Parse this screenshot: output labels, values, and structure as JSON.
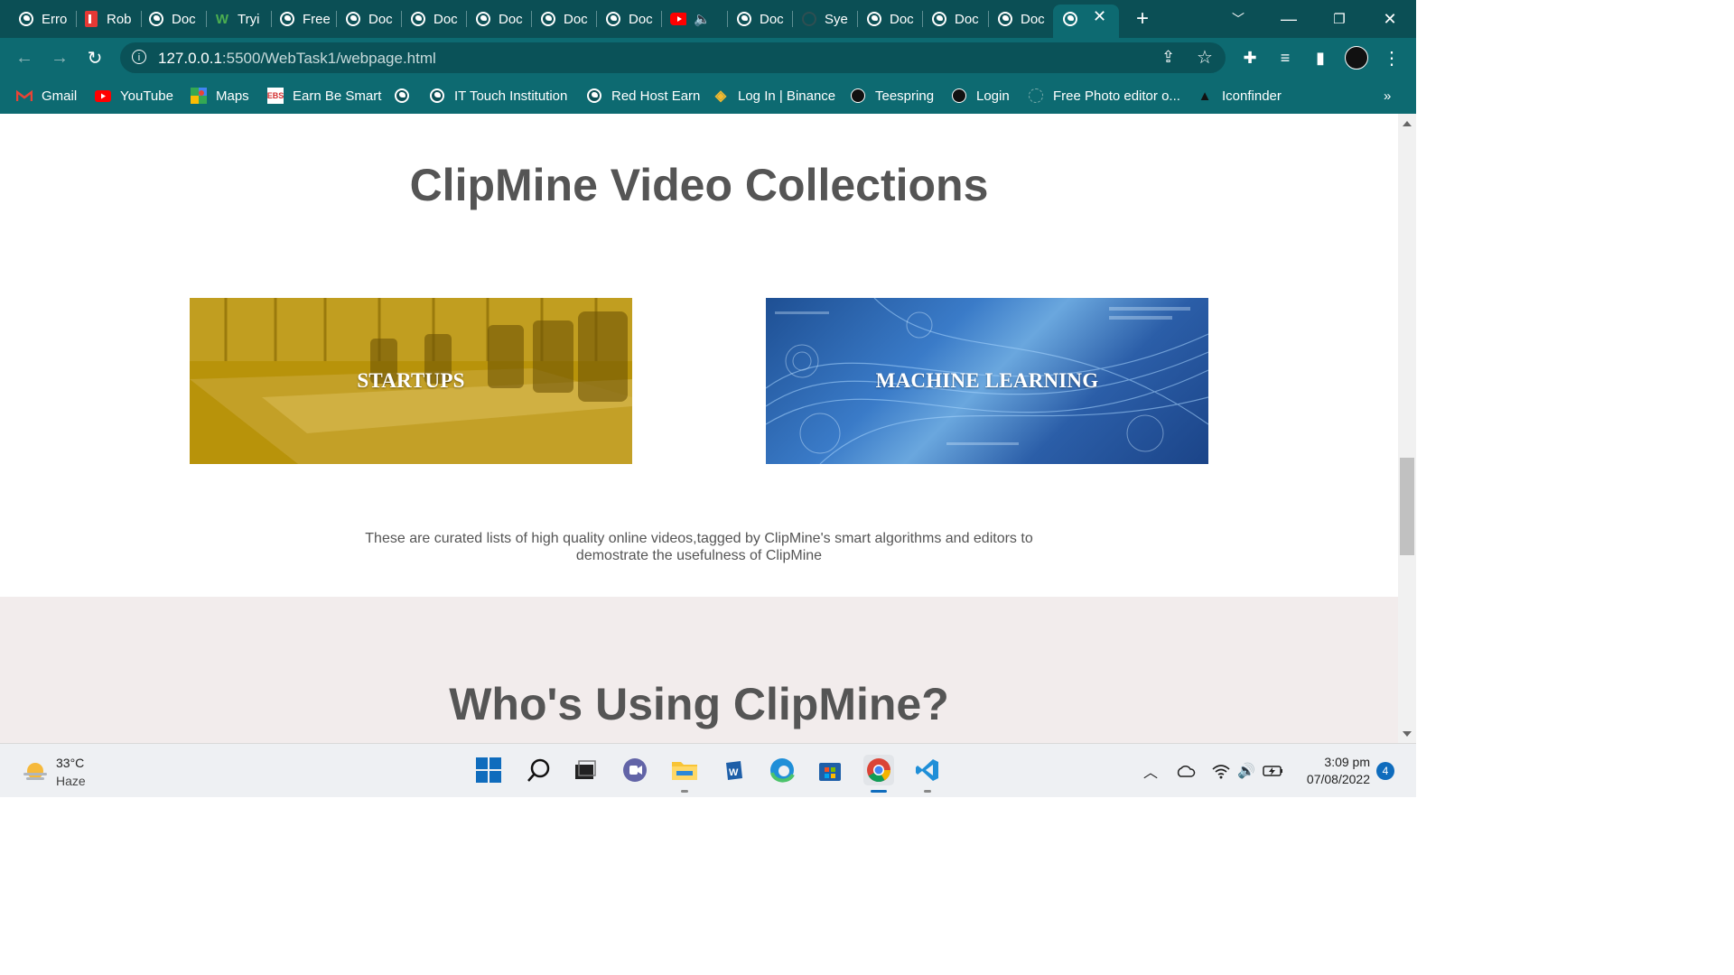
{
  "browser": {
    "tabs": [
      {
        "title": "Erro",
        "icon": "globe-icon"
      },
      {
        "title": "Rob",
        "icon": "red-document-icon"
      },
      {
        "title": "Doc",
        "icon": "globe-icon"
      },
      {
        "title": "Tryi",
        "icon": "w-logo-icon"
      },
      {
        "title": "Free",
        "icon": "globe-icon"
      },
      {
        "title": "Doc",
        "icon": "globe-icon"
      },
      {
        "title": "Doc",
        "icon": "globe-icon"
      },
      {
        "title": "Doc",
        "icon": "globe-icon"
      },
      {
        "title": "Doc",
        "icon": "globe-icon"
      },
      {
        "title": "Doc",
        "icon": "globe-icon"
      },
      {
        "title": "",
        "icon": "youtube-icon"
      },
      {
        "title": "Doc",
        "icon": "globe-icon"
      },
      {
        "title": "Sye",
        "icon": "loading-icon"
      },
      {
        "title": "Doc",
        "icon": "globe-icon"
      },
      {
        "title": "Doc",
        "icon": "globe-icon"
      },
      {
        "title": "Doc",
        "icon": "globe-icon"
      }
    ],
    "url_host": "127.0.0.1",
    "url_path": ":5500/WebTask1/webpage.html",
    "bookmarks": [
      {
        "label": "Gmail",
        "icon": "gmail-icon"
      },
      {
        "label": "YouTube",
        "icon": "youtube-icon"
      },
      {
        "label": "Maps",
        "icon": "maps-icon"
      },
      {
        "label": "Earn Be Smart",
        "icon": "ebs-icon"
      },
      {
        "label": "",
        "icon": "globe-icon"
      },
      {
        "label": "IT Touch Institution",
        "icon": "globe-icon"
      },
      {
        "label": "Red Host Earn",
        "icon": "globe-icon"
      },
      {
        "label": "Log In | Binance",
        "icon": "binance-icon"
      },
      {
        "label": "Teespring",
        "icon": "teespring-icon"
      },
      {
        "label": "Login",
        "icon": "login-icon"
      },
      {
        "label": "Free Photo editor o...",
        "icon": "photo-editor-icon"
      },
      {
        "label": "Iconfinder",
        "icon": "iconfinder-icon"
      }
    ],
    "bookmarks_overflow": "»"
  },
  "page": {
    "section_title": "ClipMine Video Collections",
    "cards": [
      {
        "label": "STARTUPS"
      },
      {
        "label": "MACHINE LEARNING"
      }
    ],
    "description": "These are curated lists of high quality online videos,tagged by ClipMine's smart algorithms and editors to demostrate the usefulness of ClipMine",
    "users_title": "Who's Using ClipMine?"
  },
  "taskbar": {
    "weather_temp": "33°C",
    "weather_desc": "Haze",
    "time": "3:09 pm",
    "date": "07/08/2022",
    "notification_count": "4"
  },
  "colors": {
    "browser_frame": "#0b4f55",
    "toolbar": "#0d6a71",
    "heading": "#555555",
    "startups_overlay": "#b8930a",
    "users_bg": "#f2ecec"
  }
}
